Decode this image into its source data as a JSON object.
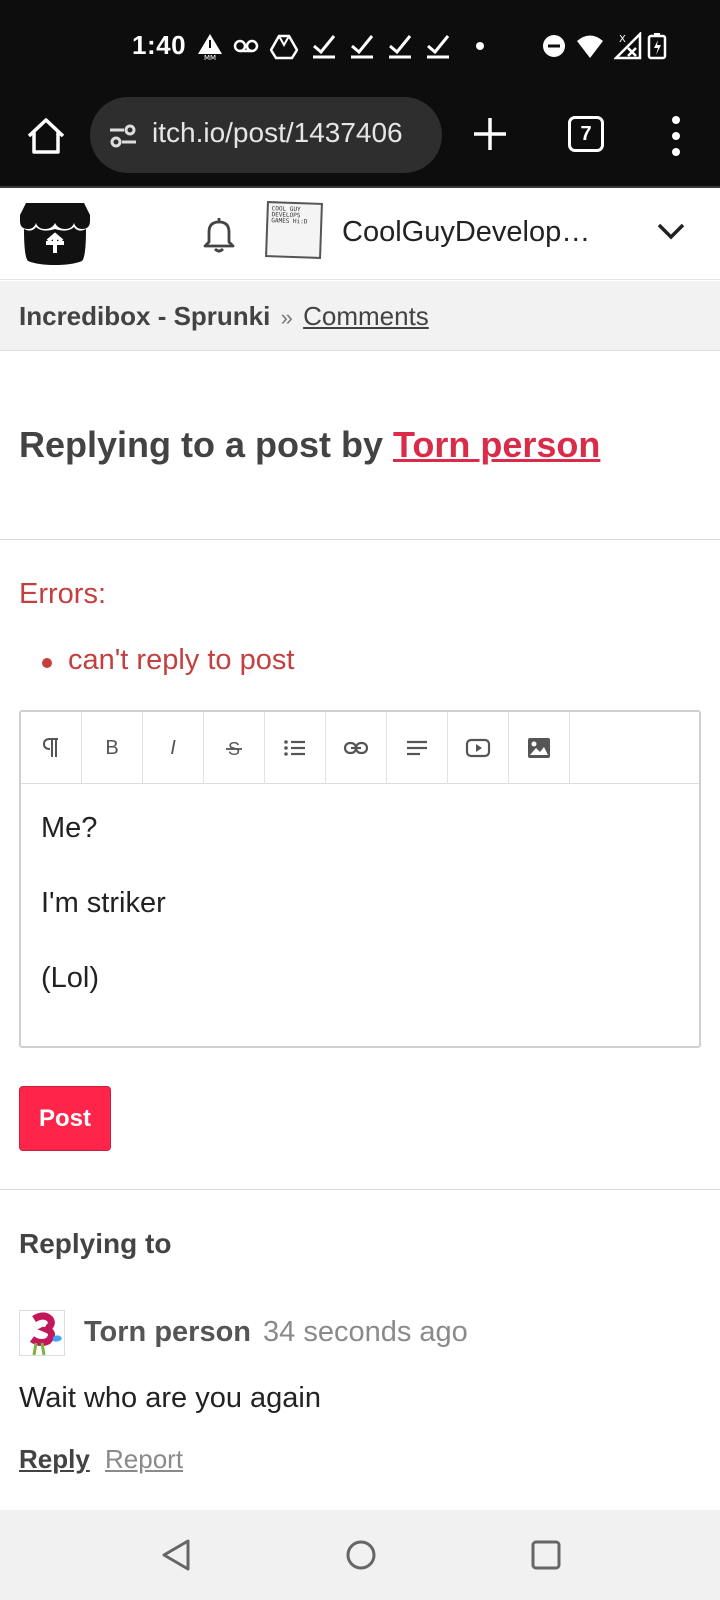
{
  "status_bar": {
    "time": "1:40",
    "tabs_count": "7",
    "icons": [
      "alert-mm-icon",
      "voicemail-icon",
      "drive-icon",
      "check-icon",
      "check-icon",
      "check-icon",
      "check-icon",
      "dot-icon",
      "dnd-icon",
      "wifi-icon",
      "no-signal-icon",
      "battery-charging-icon"
    ]
  },
  "browser": {
    "url": "itch.io/post/1437406",
    "icons": [
      "home-icon",
      "tune-icon",
      "plus-icon",
      "tabs-icon",
      "more-vert-icon"
    ]
  },
  "header": {
    "username": "CoolGuyDevelopsGames",
    "avatar_text": "COOL GUY DEVELOPS GAMES Hi:D"
  },
  "breadcrumb": {
    "game": "Incredibox - Sprunki",
    "separator": "»",
    "comments": "Comments"
  },
  "page": {
    "title_prefix": "Replying to a post by ",
    "title_author": "Torn person"
  },
  "errors": {
    "title": "Errors:",
    "items": [
      "can't reply to post"
    ]
  },
  "editor": {
    "toolbar": [
      "paragraph-icon",
      "bold-icon",
      "italic-icon",
      "strikethrough-icon",
      "list-icon",
      "link-icon",
      "align-icon",
      "video-icon",
      "image-icon"
    ],
    "bold_label": "B",
    "italic_label": "I",
    "lines": [
      "Me?",
      "I'm striker",
      "(Lol)"
    ]
  },
  "post_button": "Post",
  "replying": {
    "title": "Replying to",
    "author": "Torn person",
    "time": "34 seconds ago",
    "body": "Wait who are you again",
    "reply_label": "Reply",
    "report_label": "Report"
  },
  "colors": {
    "accent": "#da2c49",
    "post_button": "#ff2449",
    "error": "#c44040"
  }
}
